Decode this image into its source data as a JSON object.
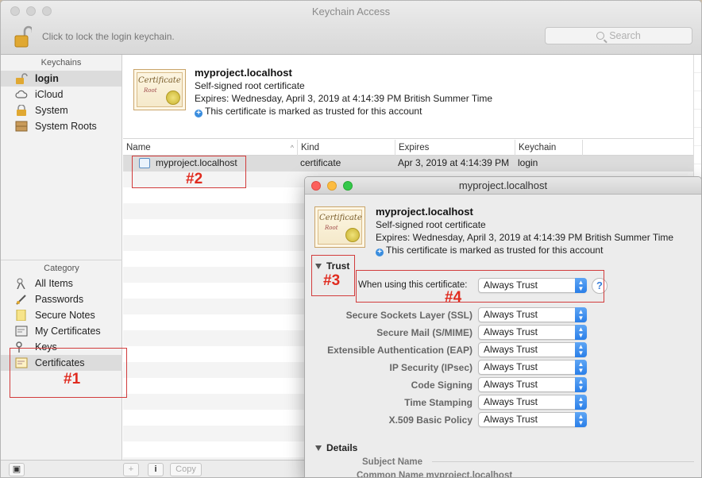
{
  "window": {
    "title": "Keychain Access",
    "lock_text": "Click to lock the login keychain.",
    "search_placeholder": "Search"
  },
  "sidebar": {
    "keychains_header": "Keychains",
    "keychains": [
      {
        "label": "login",
        "icon": "lock-open-icon",
        "selected": true
      },
      {
        "label": "iCloud",
        "icon": "cloud-icon"
      },
      {
        "label": "System",
        "icon": "lock-icon"
      },
      {
        "label": "System Roots",
        "icon": "cabinet-icon"
      }
    ],
    "category_header": "Category",
    "categories": [
      {
        "label": "All Items",
        "icon": "all-items-icon"
      },
      {
        "label": "Passwords",
        "icon": "pencil-icon"
      },
      {
        "label": "Secure Notes",
        "icon": "note-icon"
      },
      {
        "label": "My Certificates",
        "icon": "my-cert-icon"
      },
      {
        "label": "Keys",
        "icon": "key-icon"
      },
      {
        "label": "Certificates",
        "icon": "certificate-icon",
        "selected": true
      }
    ]
  },
  "info": {
    "title": "myproject.localhost",
    "subtitle": "Self-signed root certificate",
    "expires": "Expires: Wednesday, April 3, 2019 at 4:14:39 PM British Summer Time",
    "trusted": "This certificate is marked as trusted for this account",
    "cert_word": "Certificate",
    "cert_root": "Root"
  },
  "table": {
    "headers": {
      "name": "Name",
      "kind": "Kind",
      "expires": "Expires",
      "keychain": "Keychain"
    },
    "row": {
      "name": "myproject.localhost",
      "kind": "certificate",
      "expires": "Apr 3, 2019 at 4:14:39 PM",
      "keychain": "login"
    }
  },
  "bottom": {
    "add": "+",
    "info": "i",
    "copy": "Copy"
  },
  "annotations": {
    "a1": "#1",
    "a2": "#2",
    "a3": "#3",
    "a4": "#4"
  },
  "dialog": {
    "title": "myproject.localhost",
    "cert_title": "myproject.localhost",
    "subtitle": "Self-signed root certificate",
    "expires": "Expires: Wednesday, April 3, 2019 at 4:14:39 PM British Summer Time",
    "trusted": "This certificate is marked as trusted for this account",
    "trust_label": "Trust",
    "when_using_label": "When using this certificate:",
    "when_using_value": "Always Trust",
    "help": "?",
    "policies": [
      {
        "label": "Secure Sockets Layer (SSL)",
        "value": "Always Trust"
      },
      {
        "label": "Secure Mail (S/MIME)",
        "value": "Always Trust"
      },
      {
        "label": "Extensible Authentication (EAP)",
        "value": "Always Trust"
      },
      {
        "label": "IP Security (IPsec)",
        "value": "Always Trust"
      },
      {
        "label": "Code Signing",
        "value": "Always Trust"
      },
      {
        "label": "Time Stamping",
        "value": "Always Trust"
      },
      {
        "label": "X.509 Basic Policy",
        "value": "Always Trust"
      }
    ],
    "details_label": "Details",
    "subject_name": "Subject Name",
    "common_name": "Common Name   myproject.localhost"
  },
  "colors": {
    "annotation": "#e02b1f",
    "accent": "#2a7fe8",
    "close": "#fc605c",
    "minimize": "#fdbc40",
    "zoom": "#34c84a"
  }
}
